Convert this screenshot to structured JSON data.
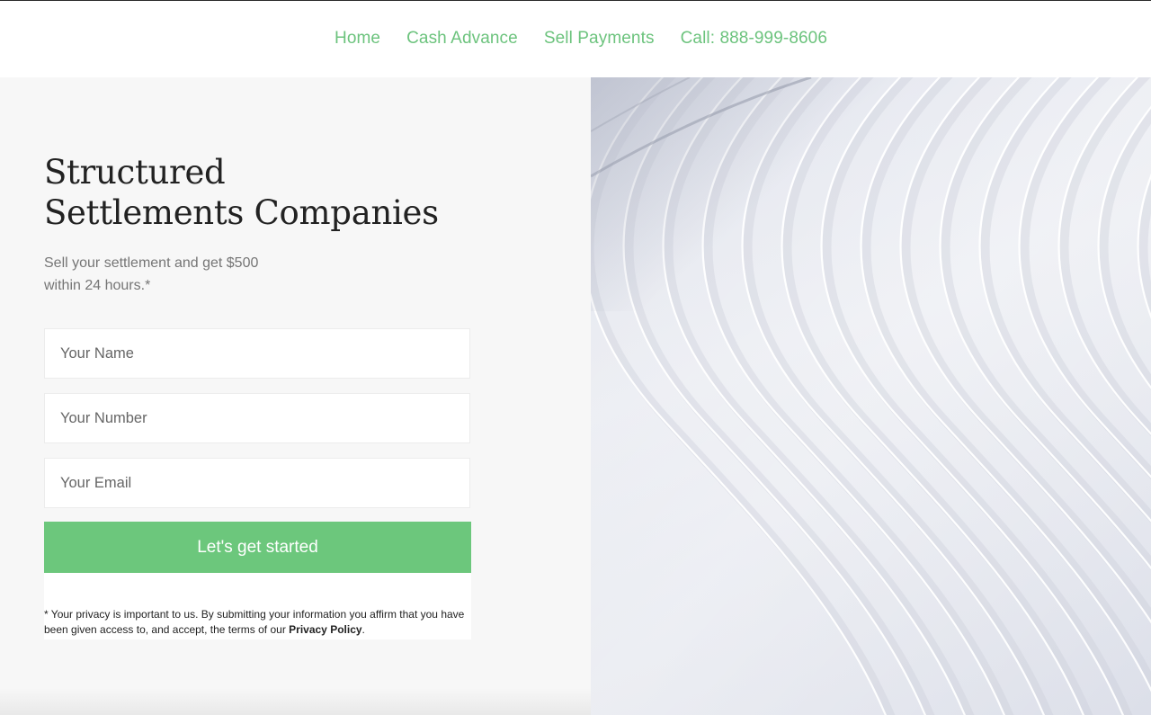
{
  "nav": {
    "items": [
      {
        "label": "Home"
      },
      {
        "label": "Cash Advance"
      },
      {
        "label": "Sell Payments"
      },
      {
        "label": "Call: 888-999-8606"
      }
    ]
  },
  "hero": {
    "headline_line1": "Structured",
    "headline_line2": "Settlements Companies",
    "subtext_line1": "Sell your settlement and get $500",
    "subtext_line2": "within 24 hours.*"
  },
  "form": {
    "name_placeholder": "Your Name",
    "number_placeholder": "Your Number",
    "email_placeholder": "Your Email",
    "submit_label": "Let's get started",
    "privacy_text": "* Your privacy is important to us. By submitting your information you affirm that you have been given access to, and accept, the terms of our ",
    "privacy_link": "Privacy Policy",
    "privacy_end": "."
  },
  "colors": {
    "accent": "#6cc77c",
    "nav_link": "#6cc37d",
    "left_panel": "#f7f7f7"
  }
}
